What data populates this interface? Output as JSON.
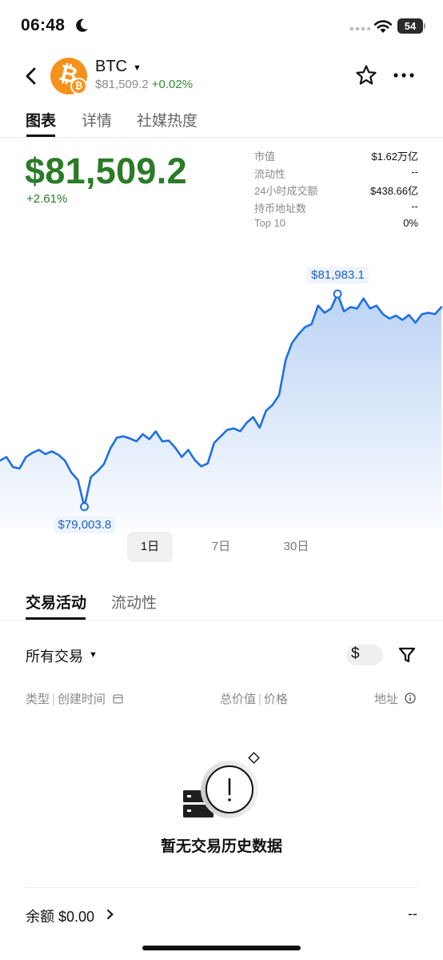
{
  "status_bar": {
    "time": "06:48",
    "battery": "54"
  },
  "header": {
    "symbol": "BTC",
    "price": "$81,509.2",
    "change": "+0.02%"
  },
  "tabs": [
    "图表",
    "详情",
    "社媒热度"
  ],
  "summary": {
    "price": "$81,509.2",
    "change": "+2.61%",
    "stats": [
      {
        "label": "市值",
        "value": "$1.62万亿"
      },
      {
        "label": "流动性",
        "value": "--"
      },
      {
        "label": "24小时成交额",
        "value": "$438.66亿"
      },
      {
        "label": "持币地址数",
        "value": "--"
      },
      {
        "label": "Top 10",
        "value": "0%"
      }
    ]
  },
  "chart_data": {
    "type": "line",
    "title": "",
    "max_label": "$81,983.1",
    "min_label": "$79,003.8",
    "max": 81983.1,
    "min": 79003.8,
    "ylim": [
      78700,
      82400
    ],
    "values": [
      79650,
      79700,
      79560,
      79540,
      79700,
      79760,
      79800,
      79740,
      79780,
      79730,
      79650,
      79480,
      79380,
      79003.8,
      79420,
      79500,
      79600,
      79820,
      79970,
      79990,
      79960,
      79920,
      80020,
      79950,
      80060,
      79920,
      79930,
      79830,
      79700,
      79800,
      79660,
      79570,
      79610,
      79900,
      79990,
      80080,
      80100,
      80060,
      80180,
      80260,
      80110,
      80350,
      80430,
      80570,
      81060,
      81300,
      81420,
      81520,
      81560,
      81820,
      81720,
      81780,
      81983.1,
      81740,
      81800,
      81780,
      81920,
      81780,
      81820,
      81700,
      81640,
      81680,
      81620,
      81690,
      81580,
      81700,
      81720,
      81700,
      81800
    ]
  },
  "ranges": [
    "1日",
    "7日",
    "30日"
  ],
  "activity_tabs": [
    "交易活动",
    "流动性"
  ],
  "filter": {
    "label": "所有交易",
    "currency": "$"
  },
  "columns": {
    "type": "类型",
    "created": "创建时间",
    "total": "总价值",
    "price": "价格",
    "address": "地址"
  },
  "empty_state": "暂无交易历史数据",
  "balance": {
    "label": "余额 $0.00",
    "value": "--"
  },
  "colors": {
    "positive": "#2b7b28",
    "line": "#1f6fe0"
  }
}
